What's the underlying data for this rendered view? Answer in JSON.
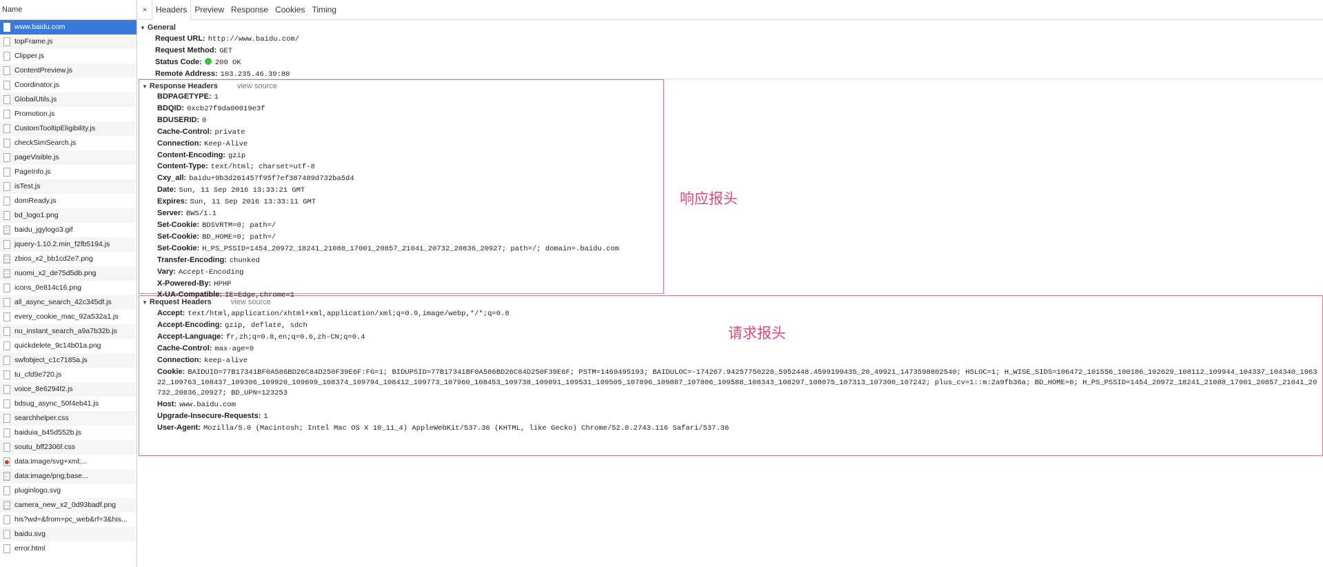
{
  "list": {
    "header": "Name",
    "items": [
      {
        "name": "www.baidu.com",
        "icon": "document-icon",
        "selected": true
      },
      {
        "name": "topFrame.js",
        "icon": "file-icon"
      },
      {
        "name": "Clipper.js",
        "icon": "file-icon"
      },
      {
        "name": "ContentPreview.js",
        "icon": "file-icon"
      },
      {
        "name": "Coordinator.js",
        "icon": "file-icon"
      },
      {
        "name": "GlobalUtils.js",
        "icon": "file-icon"
      },
      {
        "name": "Promotion.js",
        "icon": "file-icon"
      },
      {
        "name": "CustomTooltipEligibility.js",
        "icon": "file-icon"
      },
      {
        "name": "checkSimSearch.js",
        "icon": "file-icon"
      },
      {
        "name": "pageVisible.js",
        "icon": "file-icon"
      },
      {
        "name": "PageInfo.js",
        "icon": "file-icon"
      },
      {
        "name": "isTest.js",
        "icon": "file-icon"
      },
      {
        "name": "domReady.js",
        "icon": "file-icon"
      },
      {
        "name": "bd_logo1.png",
        "icon": "file-icon"
      },
      {
        "name": "baidu_jgylogo3.gif",
        "icon": "image-icon"
      },
      {
        "name": "jquery-1.10.2.min_f2fb5194.js",
        "icon": "file-icon"
      },
      {
        "name": "zbios_x2_bb1cd2e7.png",
        "icon": "image-icon"
      },
      {
        "name": "nuomi_x2_de75d5db.png",
        "icon": "image-icon"
      },
      {
        "name": "icons_0e814c16.png",
        "icon": "file-icon"
      },
      {
        "name": "all_async_search_42c345df.js",
        "icon": "file-icon"
      },
      {
        "name": "every_cookie_mac_92a532a1.js",
        "icon": "file-icon"
      },
      {
        "name": "nu_instant_search_a9a7b32b.js",
        "icon": "file-icon"
      },
      {
        "name": "quickdelete_9c14b01a.png",
        "icon": "file-icon"
      },
      {
        "name": "swfobject_c1c7185a.js",
        "icon": "file-icon"
      },
      {
        "name": "tu_cfd9e720.js",
        "icon": "file-icon"
      },
      {
        "name": "voice_8e6294f2.js",
        "icon": "file-icon"
      },
      {
        "name": "bdsug_async_50f4eb41.js",
        "icon": "file-icon"
      },
      {
        "name": "searchhelper.css",
        "icon": "file-icon"
      },
      {
        "name": "baiduia_b45d552b.js",
        "icon": "file-icon"
      },
      {
        "name": "soutu_bff2306f.css",
        "icon": "file-icon"
      },
      {
        "name": "data:image/svg+xml;...",
        "icon": "red-svg-icon"
      },
      {
        "name": "data:image/png;base...",
        "icon": "image-icon"
      },
      {
        "name": "pluginlogo.svg",
        "icon": "file-icon"
      },
      {
        "name": "camera_new_x2_0d93badf.png",
        "icon": "image-icon"
      },
      {
        "name": "his?wd=&from=pc_web&rf=3&his...",
        "icon": "file-icon"
      },
      {
        "name": "baidu.svg",
        "icon": "file-icon"
      },
      {
        "name": "error.html",
        "icon": "file-icon"
      }
    ]
  },
  "tabs": {
    "close": "×",
    "items": [
      "Headers",
      "Preview",
      "Response",
      "Cookies",
      "Timing"
    ],
    "active": "Headers"
  },
  "general": {
    "title": "General",
    "rows": [
      {
        "key": "Request URL:",
        "value": "http://www.baidu.com/"
      },
      {
        "key": "Request Method:",
        "value": "GET"
      },
      {
        "key": "Status Code:",
        "value": "200 OK",
        "status_color": "#3ec23e"
      },
      {
        "key": "Remote Address:",
        "value": "103.235.46.39:80"
      }
    ]
  },
  "response_headers": {
    "title": "Response Headers",
    "view_source": "view source",
    "rows": [
      {
        "key": "BDPAGETYPE:",
        "value": "1"
      },
      {
        "key": "BDQID:",
        "value": "0xcb27f9da00019e3f"
      },
      {
        "key": "BDUSERID:",
        "value": "0"
      },
      {
        "key": "Cache-Control:",
        "value": "private"
      },
      {
        "key": "Connection:",
        "value": "Keep-Alive"
      },
      {
        "key": "Content-Encoding:",
        "value": "gzip"
      },
      {
        "key": "Content-Type:",
        "value": "text/html; charset=utf-8"
      },
      {
        "key": "Cxy_all:",
        "value": "baidu+9b3d261457f95f7ef387489d732ba5d4"
      },
      {
        "key": "Date:",
        "value": "Sun, 11 Sep 2016 13:33:21 GMT"
      },
      {
        "key": "Expires:",
        "value": "Sun, 11 Sep 2016 13:33:11 GMT"
      },
      {
        "key": "Server:",
        "value": "BWS/1.1"
      },
      {
        "key": "Set-Cookie:",
        "value": "BDSVRTM=0; path=/"
      },
      {
        "key": "Set-Cookie:",
        "value": "BD_HOME=0; path=/"
      },
      {
        "key": "Set-Cookie:",
        "value": "H_PS_PSSID=1454_20972_18241_21088_17001_20857_21041_20732_20836_20927; path=/; domain=.baidu.com"
      },
      {
        "key": "Transfer-Encoding:",
        "value": "chunked"
      },
      {
        "key": "Vary:",
        "value": "Accept-Encoding"
      },
      {
        "key": "X-Powered-By:",
        "value": "HPHP"
      },
      {
        "key": "X-UA-Compatible:",
        "value": "IE=Edge,chrome=1"
      }
    ]
  },
  "request_headers": {
    "title": "Request Headers",
    "view_source": "view source",
    "rows": [
      {
        "key": "Accept:",
        "value": "text/html,application/xhtml+xml,application/xml;q=0.9,image/webp,*/*;q=0.8"
      },
      {
        "key": "Accept-Encoding:",
        "value": "gzip, deflate, sdch"
      },
      {
        "key": "Accept-Language:",
        "value": "fr,zh;q=0.8,en;q=0.6,zh-CN;q=0.4"
      },
      {
        "key": "Cache-Control:",
        "value": "max-age=0"
      },
      {
        "key": "Connection:",
        "value": "keep-alive"
      },
      {
        "key": "Cookie:",
        "value": "BAIDUID=77B17341BF0A586BD26C84D250F39E6F:FG=1; BIDUPSID=77B17341BF0A586BD26C84D250F39E6F; PSTM=1469495193; BAIDULOC=-174267.94257750228_5952448.4599199435_20_49921_1473598802540; H5LOC=1; H_WISE_SIDS=106472_101556_100186_102629_108112_109944_104337_104340_106322_109763_108437_109306_109920_109699_108374_109794_108412_109773_107960_108453_109738_109891_109531_109505_107896_109887_107806_109588_108343_108297_108075_107313_107300_107242; plus_cv=1::m:2a9fb36a; BD_HOME=0; H_PS_PSSID=1454_20972_18241_21088_17001_20857_21041_20732_20836_20927; BD_UPN=123253",
        "cookie": true
      },
      {
        "key": "Host:",
        "value": "www.baidu.com"
      },
      {
        "key": "Upgrade-Insecure-Requests:",
        "value": "1"
      },
      {
        "key": "User-Agent:",
        "value": "Mozilla/5.0 (Macintosh; Intel Mac OS X 10_11_4) AppleWebKit/537.36 (KHTML, like Gecko) Chrome/52.0.2743.116 Safari/537.36"
      }
    ]
  },
  "annotations": {
    "response_label": "响应报头",
    "request_label": "请求报头",
    "color": "#e0467e"
  }
}
